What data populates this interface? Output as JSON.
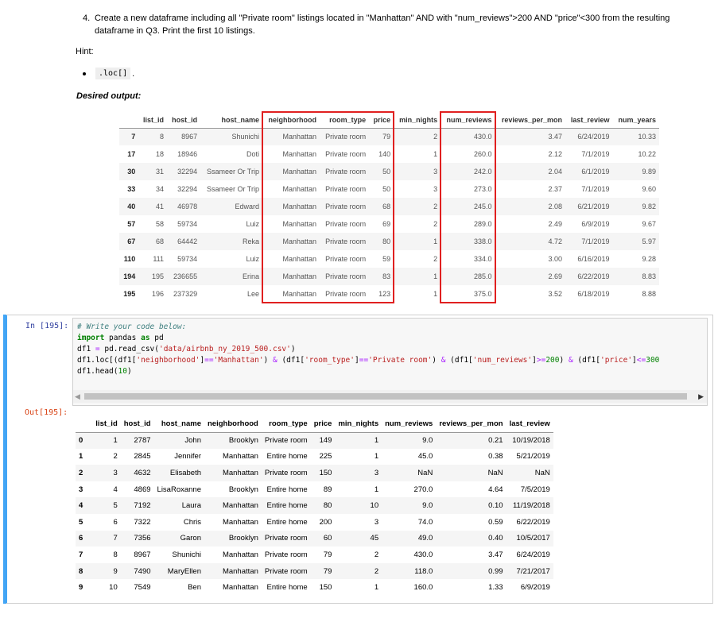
{
  "question": {
    "number": "4.",
    "text": "Create a new dataframe including all \"Private room\" listings located in \"Manhattan\" AND with \"num_reviews\">200 AND \"price\"<300 from the resulting dataframe in Q3. Print the first 10 listings."
  },
  "hint": {
    "label": "Hint:",
    "code": ".loc[]",
    "period": "."
  },
  "desired_label": "Desired output:",
  "desired_table": {
    "columns": [
      "",
      "list_id",
      "host_id",
      "host_name",
      "neighborhood",
      "room_type",
      "price",
      "min_nights",
      "num_reviews",
      "reviews_per_mon",
      "last_review",
      "num_years"
    ],
    "rows": [
      [
        "7",
        "8",
        "8967",
        "Shunichi",
        "Manhattan",
        "Private room",
        "79",
        "2",
        "430.0",
        "3.47",
        "6/24/2019",
        "10.33"
      ],
      [
        "17",
        "18",
        "18946",
        "Doti",
        "Manhattan",
        "Private room",
        "140",
        "1",
        "260.0",
        "2.12",
        "7/1/2019",
        "10.22"
      ],
      [
        "30",
        "31",
        "32294",
        "Ssameer Or Trip",
        "Manhattan",
        "Private room",
        "50",
        "3",
        "242.0",
        "2.04",
        "6/1/2019",
        "9.89"
      ],
      [
        "33",
        "34",
        "32294",
        "Ssameer Or Trip",
        "Manhattan",
        "Private room",
        "50",
        "3",
        "273.0",
        "2.37",
        "7/1/2019",
        "9.60"
      ],
      [
        "40",
        "41",
        "46978",
        "Edward",
        "Manhattan",
        "Private room",
        "68",
        "2",
        "245.0",
        "2.08",
        "6/21/2019",
        "9.82"
      ],
      [
        "57",
        "58",
        "59734",
        "Luiz",
        "Manhattan",
        "Private room",
        "69",
        "2",
        "289.0",
        "2.49",
        "6/9/2019",
        "9.67"
      ],
      [
        "67",
        "68",
        "64442",
        "Reka",
        "Manhattan",
        "Private room",
        "80",
        "1",
        "338.0",
        "4.72",
        "7/1/2019",
        "5.97"
      ],
      [
        "110",
        "111",
        "59734",
        "Luiz",
        "Manhattan",
        "Private room",
        "59",
        "2",
        "334.0",
        "3.00",
        "6/16/2019",
        "9.28"
      ],
      [
        "194",
        "195",
        "236655",
        "Erina",
        "Manhattan",
        "Private room",
        "83",
        "1",
        "285.0",
        "2.69",
        "6/22/2019",
        "8.83"
      ],
      [
        "195",
        "196",
        "237329",
        "Lee",
        "Manhattan",
        "Private room",
        "123",
        "1",
        "375.0",
        "3.52",
        "6/18/2019",
        "8.88"
      ]
    ]
  },
  "cell": {
    "in_prompt": "In [195]:",
    "out_prompt": "Out[195]:",
    "code_lines": [
      [
        [
          "c-comment",
          "# Write your code below:"
        ]
      ],
      [
        [
          "c-kw",
          "import"
        ],
        [
          "",
          " pandas "
        ],
        [
          "c-kw",
          "as"
        ],
        [
          "",
          " pd"
        ]
      ],
      [
        [
          "",
          "df1 "
        ],
        [
          "c-op",
          "="
        ],
        [
          "",
          " pd.read_csv("
        ],
        [
          "c-str",
          "'data/airbnb_ny_2019_500.csv'"
        ],
        [
          "",
          ")"
        ]
      ],
      [
        [
          "",
          "df1.loc[(df1["
        ],
        [
          "c-str",
          "'neighborhood'"
        ],
        [
          "",
          "]"
        ],
        [
          "c-op",
          "=="
        ],
        [
          "c-str",
          "'Manhattan'"
        ],
        [
          "",
          ") "
        ],
        [
          "c-op",
          "&"
        ],
        [
          "",
          " (df1["
        ],
        [
          "c-str",
          "'room_type'"
        ],
        [
          "",
          "]"
        ],
        [
          "c-op",
          "=="
        ],
        [
          "c-str",
          "'Private room'"
        ],
        [
          "",
          ") "
        ],
        [
          "c-op",
          "&"
        ],
        [
          "",
          " (df1["
        ],
        [
          "c-str",
          "'num_reviews'"
        ],
        [
          "",
          "]"
        ],
        [
          "c-op",
          ">="
        ],
        [
          "c-num",
          "200"
        ],
        [
          "",
          ") "
        ],
        [
          "c-op",
          "&"
        ],
        [
          "",
          " (df1["
        ],
        [
          "c-str",
          "'price'"
        ],
        [
          "",
          "]"
        ],
        [
          "c-op",
          "<="
        ],
        [
          "c-num",
          "300"
        ]
      ],
      [
        [
          "",
          "df1.head("
        ],
        [
          "c-num",
          "10"
        ],
        [
          "",
          ")"
        ]
      ]
    ],
    "scroll_left": "◀",
    "scroll_right": "▶"
  },
  "output_table": {
    "columns": [
      "",
      "list_id",
      "host_id",
      "host_name",
      "neighborhood",
      "room_type",
      "price",
      "min_nights",
      "num_reviews",
      "reviews_per_mon",
      "last_review"
    ],
    "rows": [
      [
        "0",
        "1",
        "2787",
        "John",
        "Brooklyn",
        "Private room",
        "149",
        "1",
        "9.0",
        "0.21",
        "10/19/2018"
      ],
      [
        "1",
        "2",
        "2845",
        "Jennifer",
        "Manhattan",
        "Entire home",
        "225",
        "1",
        "45.0",
        "0.38",
        "5/21/2019"
      ],
      [
        "2",
        "3",
        "4632",
        "Elisabeth",
        "Manhattan",
        "Private room",
        "150",
        "3",
        "NaN",
        "NaN",
        "NaN"
      ],
      [
        "3",
        "4",
        "4869",
        "LisaRoxanne",
        "Brooklyn",
        "Entire home",
        "89",
        "1",
        "270.0",
        "4.64",
        "7/5/2019"
      ],
      [
        "4",
        "5",
        "7192",
        "Laura",
        "Manhattan",
        "Entire home",
        "80",
        "10",
        "9.0",
        "0.10",
        "11/19/2018"
      ],
      [
        "5",
        "6",
        "7322",
        "Chris",
        "Manhattan",
        "Entire home",
        "200",
        "3",
        "74.0",
        "0.59",
        "6/22/2019"
      ],
      [
        "6",
        "7",
        "7356",
        "Garon",
        "Brooklyn",
        "Private room",
        "60",
        "45",
        "49.0",
        "0.40",
        "10/5/2017"
      ],
      [
        "7",
        "8",
        "8967",
        "Shunichi",
        "Manhattan",
        "Private room",
        "79",
        "2",
        "430.0",
        "3.47",
        "6/24/2019"
      ],
      [
        "8",
        "9",
        "7490",
        "MaryEllen",
        "Manhattan",
        "Private room",
        "79",
        "2",
        "118.0",
        "0.99",
        "7/21/2017"
      ],
      [
        "9",
        "10",
        "7549",
        "Ben",
        "Manhattan",
        "Entire home",
        "150",
        "1",
        "160.0",
        "1.33",
        "6/9/2019"
      ]
    ]
  },
  "highlight_color": "#e02020",
  "cell_accent_color": "#42a5f5"
}
